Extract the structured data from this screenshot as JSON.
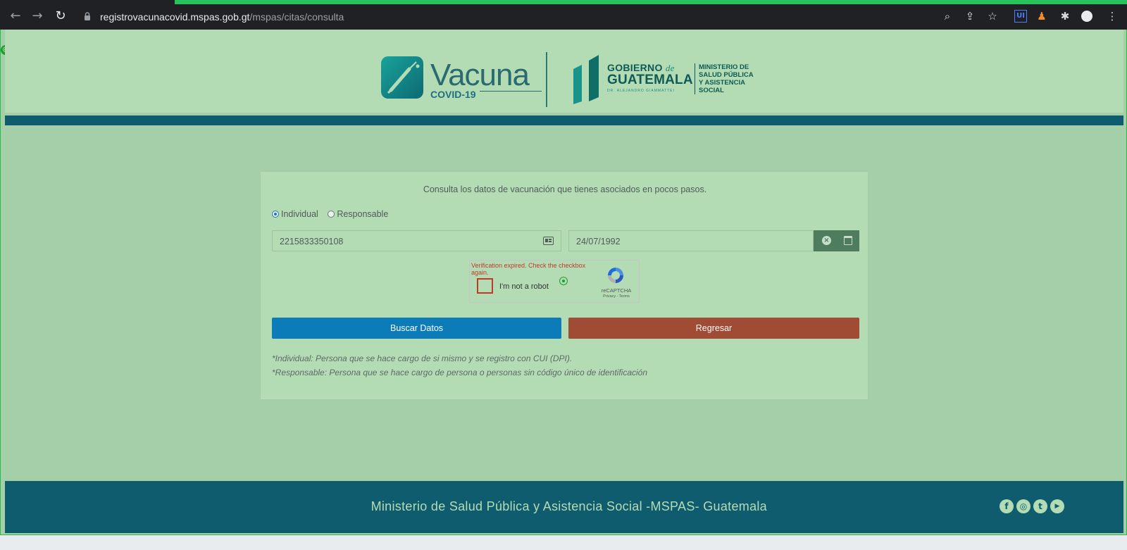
{
  "browser": {
    "url_domain": "registrovacunacovid.mspas.gob.gt",
    "url_path": "/mspas/citas/consulta",
    "extension_label": "UI",
    "icons": [
      "back-icon",
      "forward-icon",
      "reload-icon",
      "lock-icon",
      "zoom-icon",
      "share-icon",
      "star-icon",
      "puzzle-icon",
      "profile-icon",
      "menu-icon"
    ]
  },
  "header": {
    "vacuna_word": "Vacuna",
    "vacuna_sub": "COVID-19",
    "gob_line1": "GOBIERNO",
    "gob_de": "de",
    "gob_line2": "GUATEMALA",
    "gob_line3": "DR. ALEJANDRO GIAMMATTEI",
    "ministry_lines": [
      "MINISTERIO DE",
      "SALUD PÚBLICA",
      "Y ASISTENCIA",
      "SOCIAL"
    ]
  },
  "form": {
    "intro": "Consulta los datos de vacunación que tienes asociados en pocos pasos.",
    "radio_individual": "Individual",
    "radio_responsable": "Responsable",
    "selected_radio": "Individual",
    "cui_value": "2215833350108",
    "date_value": "24/07/1992",
    "captcha": {
      "error": "Verification expired. Check the checkbox again.",
      "label": "I'm not a robot",
      "brand": "reCAPTCHA",
      "links": "Privacy - Terms"
    },
    "buscar_label": "Buscar Datos",
    "regresar_label": "Regresar",
    "note_individual": "*Individual: Persona que se hace cargo de si mismo y se registro con CUI (DPI).",
    "note_responsable": "*Responsable: Persona que se hace cargo de persona o personas sin código único de identificación"
  },
  "footer": {
    "text": "Ministerio de Salud Pública y Asistencia Social -MSPAS- Guatemala",
    "social": [
      {
        "name": "facebook-icon",
        "glyph": "f"
      },
      {
        "name": "instagram-icon",
        "glyph": "◎"
      },
      {
        "name": "twitter-icon",
        "glyph": "t"
      },
      {
        "name": "youtube-icon",
        "glyph": "▶"
      }
    ]
  },
  "colors": {
    "page_bg": "#a4cfa8",
    "header_bg": "#b4dcb4",
    "brand_teal": "#0f5c6f",
    "buscar_blue": "#0b7cb8",
    "regresar_red": "#a04b34",
    "error_red": "#c0392b"
  }
}
